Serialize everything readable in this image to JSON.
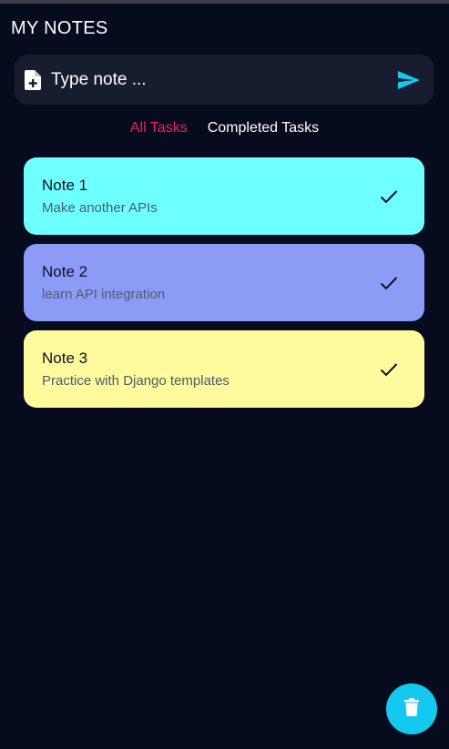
{
  "header": {
    "title": "MY NOTES"
  },
  "composer": {
    "placeholder": "Type note ...",
    "doc_icon": "note-add-icon",
    "send_icon": "send-icon",
    "send_color": "#13c9f0"
  },
  "tabs": [
    {
      "label": "All Tasks",
      "active": true,
      "color": "#ee1f6c"
    },
    {
      "label": "Completed Tasks",
      "active": false,
      "color": "#ffffff"
    }
  ],
  "notes": [
    {
      "title": "Note 1",
      "subtitle": "Make another APIs",
      "color": "#6effff",
      "icon": "check-icon"
    },
    {
      "title": "Note 2",
      "subtitle": "learn API integration",
      "color": "#8c9cf6",
      "icon": "check-icon"
    },
    {
      "title": "Note 3",
      "subtitle": "Practice with Django templates",
      "color": "#fffb9c",
      "icon": "check-icon"
    }
  ],
  "fab": {
    "icon": "trash-icon",
    "color": "#13c9f0"
  }
}
